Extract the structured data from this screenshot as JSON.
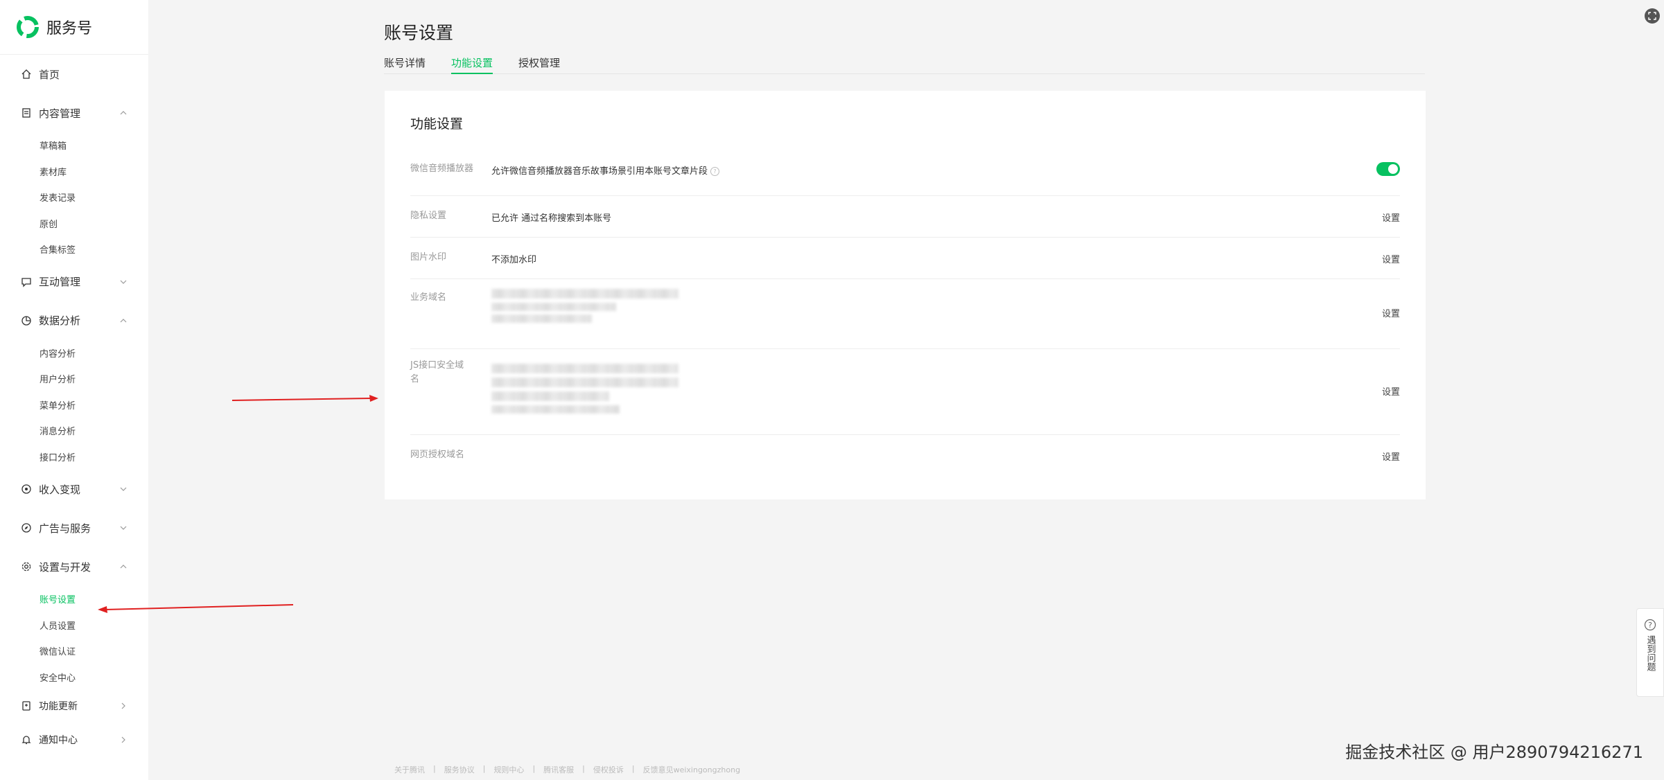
{
  "brand": {
    "name": "服务号",
    "logo_color": "#07c160"
  },
  "sidebar": {
    "items": [
      {
        "label": "首页",
        "icon": "home-icon"
      },
      {
        "label": "内容管理",
        "icon": "document-icon",
        "expanded": true,
        "children": [
          "草稿箱",
          "素材库",
          "发表记录",
          "原创",
          "合集标签"
        ]
      },
      {
        "label": "互动管理",
        "icon": "chat-icon",
        "expanded": false
      },
      {
        "label": "数据分析",
        "icon": "pie-chart-icon",
        "expanded": true,
        "children": [
          "内容分析",
          "用户分析",
          "菜单分析",
          "消息分析",
          "接口分析"
        ]
      },
      {
        "label": "收入变现",
        "icon": "money-icon",
        "expanded": false
      },
      {
        "label": "广告与服务",
        "icon": "compass-icon",
        "expanded": false
      },
      {
        "label": "设置与开发",
        "icon": "gear-icon",
        "expanded": true,
        "children": [
          "账号设置",
          "人员设置",
          "微信认证",
          "安全中心"
        ],
        "active_child": "账号设置"
      },
      {
        "label": "功能更新",
        "icon": "update-icon"
      },
      {
        "label": "通知中心",
        "icon": "bell-icon"
      }
    ]
  },
  "page": {
    "title": "账号设置",
    "tabs": [
      "账号详情",
      "功能设置",
      "授权管理"
    ],
    "active_tab": "功能设置"
  },
  "card": {
    "title": "功能设置",
    "rows": [
      {
        "label": "微信音频播放器",
        "value": "允许微信音频播放器音乐故事场景引用本账号文章片段",
        "has_help": true,
        "action": "toggle",
        "toggle_on": true
      },
      {
        "label": "隐私设置",
        "value": "已允许 通过名称搜索到本账号",
        "action": "设置"
      },
      {
        "label": "图片水印",
        "value": "不添加水印",
        "action": "设置"
      },
      {
        "label": "业务域名",
        "value": "",
        "blurred": true,
        "action": "设置"
      },
      {
        "label": "JS接口安全域名",
        "value": "",
        "blurred": true,
        "action": "设置"
      },
      {
        "label": "网页授权域名",
        "value": "",
        "action": "设置"
      }
    ]
  },
  "footer": {
    "links": [
      "关于腾讯",
      "服务协议",
      "规则中心",
      "腾讯客服",
      "侵权投诉",
      "反馈意见weixingongzhong"
    ]
  },
  "help_widget": {
    "label": "遇到问题"
  },
  "watermark": "掘金技术社区 @ 用户2890794216271",
  "colors": {
    "accent": "#07c160",
    "annotation_arrow": "#e02020"
  }
}
